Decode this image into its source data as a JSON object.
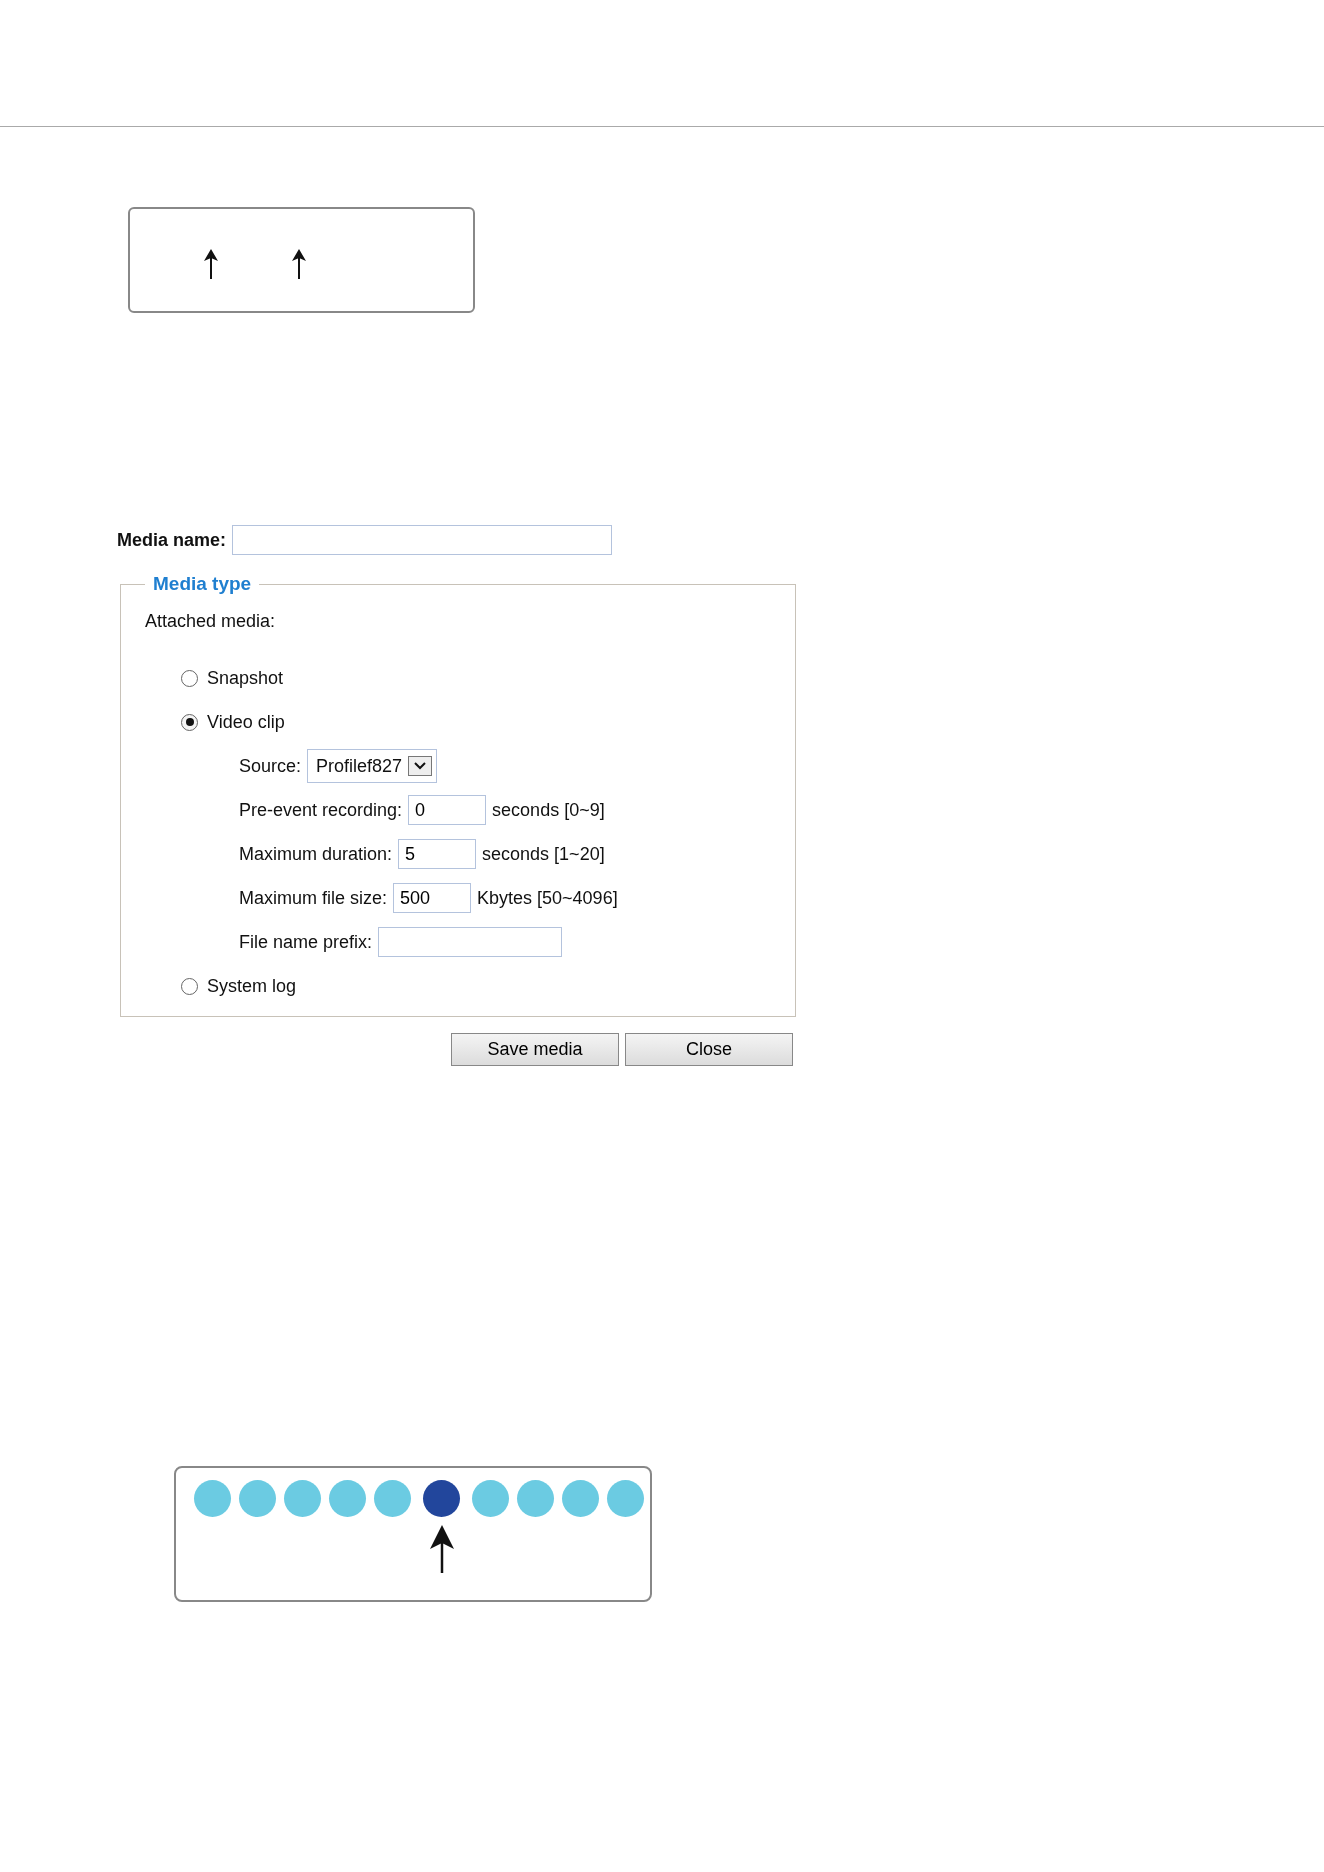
{
  "media_name": {
    "label": "Media name:"
  },
  "media_type": {
    "legend": "Media type",
    "attached_label": "Attached media:",
    "options": [
      {
        "label": "Snapshot",
        "selected": false
      },
      {
        "label": "Video clip",
        "selected": true,
        "fields": [
          {
            "kind": "select",
            "label": "Source:",
            "value": "Profilef827"
          },
          {
            "kind": "text",
            "label": "Pre-event recording:",
            "value": "0",
            "hint": "seconds [0~9]"
          },
          {
            "kind": "text",
            "label": "Maximum duration:",
            "value": "5",
            "hint": "seconds [1~20]"
          },
          {
            "kind": "text",
            "label": "Maximum file size:",
            "value": "500",
            "hint": "Kbytes [50~4096]"
          },
          {
            "kind": "long_text",
            "label": "File name prefix:"
          }
        ]
      },
      {
        "label": "System log",
        "selected": false
      }
    ]
  },
  "buttons": [
    "Save media",
    "Close"
  ],
  "dots": [
    {
      "selected": false
    },
    {
      "selected": false
    },
    {
      "selected": false
    },
    {
      "selected": false
    },
    {
      "selected": false
    },
    {
      "selected": true
    },
    {
      "selected": false
    },
    {
      "selected": false
    },
    {
      "selected": false
    },
    {
      "selected": false
    }
  ]
}
